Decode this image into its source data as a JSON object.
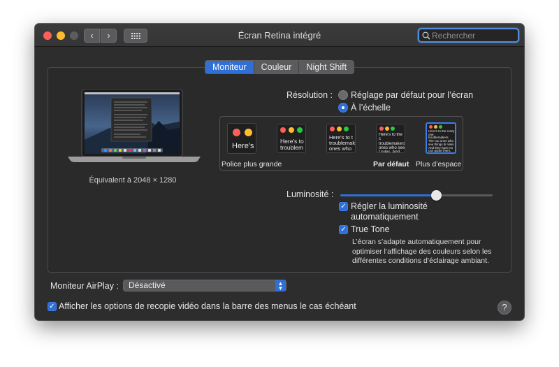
{
  "window": {
    "title": "Écran Retina intégré",
    "back_glyph": "‹",
    "forward_glyph": "›"
  },
  "search": {
    "placeholder": "Rechercher",
    "value": ""
  },
  "tabs": [
    {
      "label": "Moniteur",
      "active": true
    },
    {
      "label": "Couleur",
      "active": false
    },
    {
      "label": "Night Shift",
      "active": false
    }
  ],
  "display": {
    "equivalent": "Équivalent à 2048 × 1280"
  },
  "resolution": {
    "label": "Résolution :",
    "options": [
      {
        "label": "Réglage par défaut pour l’écran",
        "selected": false
      },
      {
        "label": "À l’échelle",
        "selected": true
      }
    ]
  },
  "scaling": {
    "thumbnails": [
      {
        "text": "Here's",
        "selected": false
      },
      {
        "text": "Here's to troublem",
        "selected": false
      },
      {
        "text": "Here's to t troublemak ones who",
        "selected": false
      },
      {
        "text": "Here's to the c troublemakers. ones who see t rules. And they",
        "selected": false
      },
      {
        "text": "Here's to the crazy one troublemakers. The rou ones who see things di rules. And they have no can quote them, disagre about the only thing Because they change t",
        "selected": true
      }
    ],
    "labels": {
      "larger": "Police plus grande",
      "default": "Par défaut",
      "more_space": "Plus d’espace"
    }
  },
  "brightness": {
    "label": "Luminosité :",
    "level": 0.63
  },
  "auto_brightness": {
    "label_line1": "Régler la luminosité",
    "label_line2": "automatiquement",
    "checked": true
  },
  "true_tone": {
    "label": "True Tone",
    "checked": true,
    "description_lines": [
      "L’écran s’adapte automatiquement pour",
      "optimiser l’affichage des couleurs selon les",
      "différentes conditions d’éclairage ambiant."
    ]
  },
  "airplay": {
    "label": "Moniteur AirPlay :",
    "value": "Désactivé"
  },
  "mirroring": {
    "label": "Afficher les options de recopie vidéo dans la barre des menus le cas échéant",
    "checked": true
  },
  "help": {
    "glyph": "?"
  },
  "colors": {
    "accent": "#2f6fd6",
    "window_bg": "#2d2d2e",
    "close": "#fe5f57",
    "minimize": "#febc2e"
  }
}
